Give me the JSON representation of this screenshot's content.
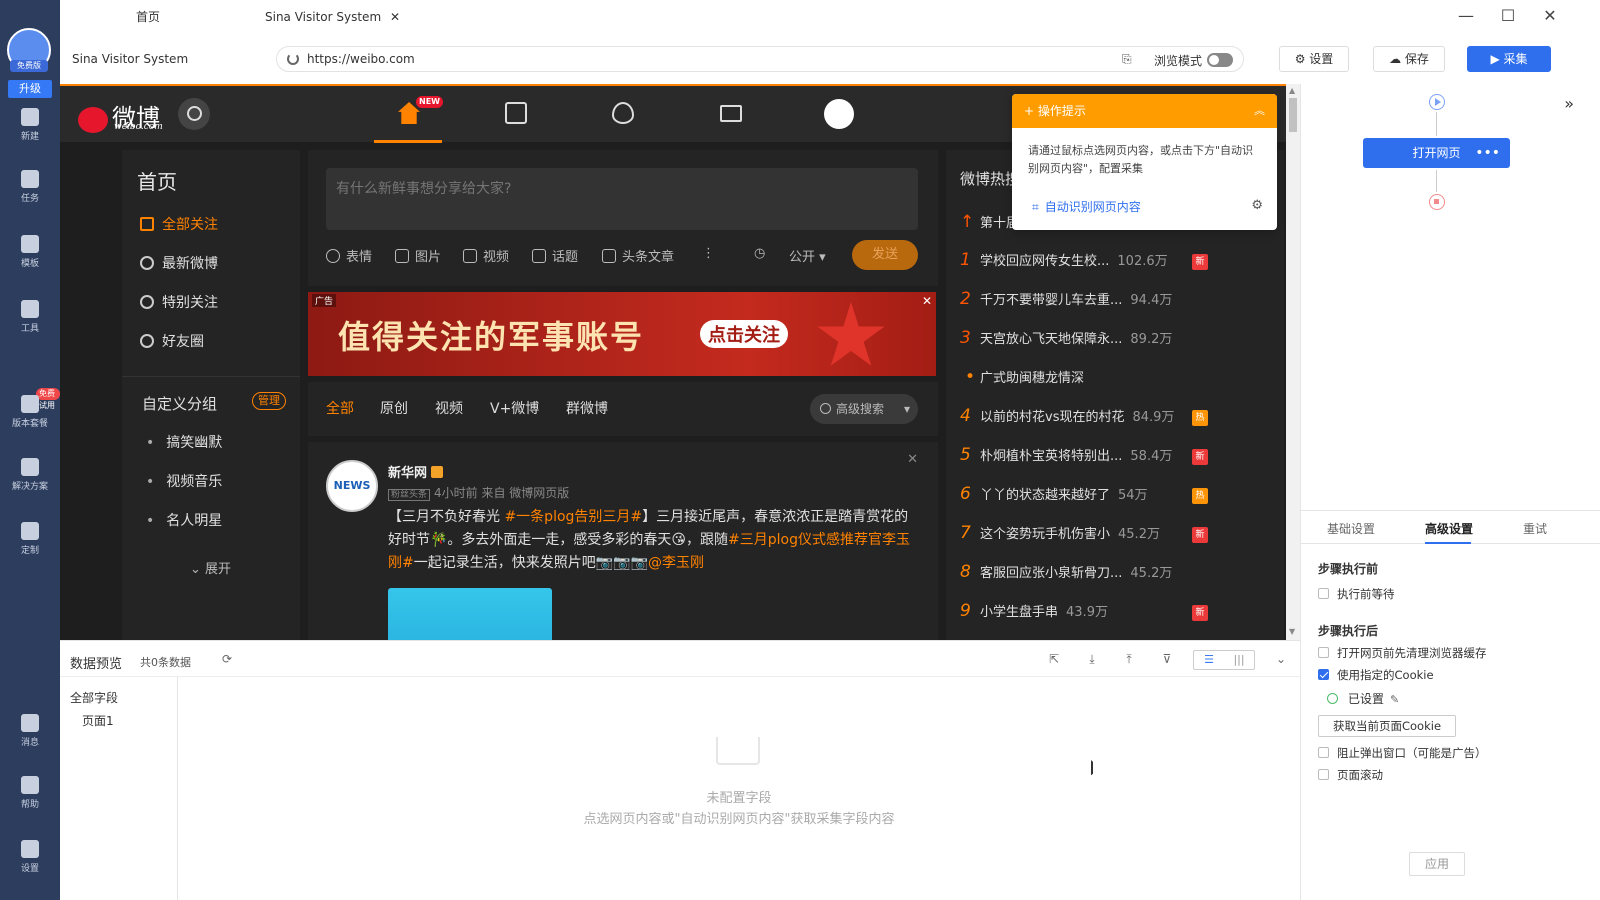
{
  "rail": {
    "avatar_tag": "免费版",
    "upgrade": "升级",
    "items": [
      {
        "label": "新建",
        "icon": "plus-icon"
      },
      {
        "label": "任务",
        "icon": "bookmark-icon"
      },
      {
        "label": "模板",
        "icon": "template-icon"
      },
      {
        "label": "工具",
        "icon": "toolbox-icon"
      },
      {
        "label": "版本套餐",
        "icon": "crown-icon"
      },
      {
        "label": "解决方案",
        "icon": "solution-icon"
      },
      {
        "label": "定制",
        "icon": "custom-icon"
      },
      {
        "label": "消息",
        "icon": "bell-icon"
      },
      {
        "label": "帮助",
        "icon": "help-icon"
      },
      {
        "label": "设置",
        "icon": "gear-icon"
      }
    ],
    "trial_badge": "免费试用"
  },
  "titlebar": {
    "tabs": [
      "首页",
      "Sina Visitor System"
    ],
    "close_tab": "✕",
    "minimize": "—",
    "maximize": "☐",
    "close": "✕"
  },
  "address": {
    "site_title": "Sina Visitor System",
    "url": "https://weibo.com",
    "browse_mode": "浏览模式",
    "settings": "设置",
    "save": "保存",
    "collect": "▶ 采集"
  },
  "weibo": {
    "logo": "微博",
    "logo_sub": "weibo.com",
    "nav_new": "NEW",
    "left": {
      "title": "首页",
      "items": [
        "全部关注",
        "最新微博",
        "特别关注",
        "好友圈"
      ],
      "group_title": "自定义分组",
      "manage": "管理",
      "subs": [
        "搞笑幽默",
        "视频音乐",
        "名人明星"
      ],
      "expand": "⌄ 展开"
    },
    "composer": {
      "placeholder": "有什么新鲜事想分享给大家?",
      "tools": [
        "表情",
        "图片",
        "视频",
        "话题",
        "头条文章"
      ],
      "more": "⋮",
      "visibility": "公开 ▾",
      "send": "发送"
    },
    "ad": {
      "label": "广告",
      "text": "值得关注的军事账号",
      "button": "点击关注",
      "close": "✕"
    },
    "filters": [
      "全部",
      "原创",
      "视频",
      "V+微博",
      "群微博"
    ],
    "advanced_search": "高级搜索",
    "post": {
      "avatar_text": "NEWS",
      "name": "新华网",
      "fan_badge": "粉丝头条",
      "meta": "4小时前 来自 微博网页版",
      "text_parts": [
        {
          "t": "【三月不负好春光 ",
          "tag": false
        },
        {
          "t": "#一条plog告别三月#",
          "tag": true
        },
        {
          "t": "】三月接近尾声，春意浓浓正是踏青赏花的好时节🎋。多去外面走一走，感受多彩的春天😘，跟随",
          "tag": false
        },
        {
          "t": "#三月plog仪式感推荐官李玉刚#",
          "tag": true
        },
        {
          "t": "一起记录生活，快来发照片吧📷📷📷",
          "tag": false
        },
        {
          "t": "@李玉刚",
          "tag": true
        }
      ],
      "close": "✕"
    },
    "hot": {
      "title": "微博热搜",
      "pinned": "第十届",
      "rows": [
        {
          "rank": "1",
          "text": "学校回应网传女生校...",
          "count": "102.6万",
          "badge": "新"
        },
        {
          "rank": "2",
          "text": "千万不要带婴儿车去重...",
          "count": "94.4万",
          "badge": ""
        },
        {
          "rank": "3",
          "text": "天宫放心飞天地保障永...",
          "count": "89.2万",
          "badge": ""
        },
        {
          "rank": "•",
          "text": "广式助闽穗龙情深",
          "count": "",
          "badge": ""
        },
        {
          "rank": "4",
          "text": "以前的村花vs现在的村花",
          "count": "84.9万",
          "badge": "热"
        },
        {
          "rank": "5",
          "text": "朴炯植朴宝英将特别出...",
          "count": "58.4万",
          "badge": "新"
        },
        {
          "rank": "6",
          "text": "丫丫的状态越来越好了",
          "count": "54万",
          "badge": "热"
        },
        {
          "rank": "7",
          "text": "这个姿势玩手机伤害小",
          "count": "45.2万",
          "badge": "新"
        },
        {
          "rank": "8",
          "text": "客服回应张小泉斩骨刀...",
          "count": "45.2万",
          "badge": ""
        },
        {
          "rank": "9",
          "text": "小学生盘手串",
          "count": "43.9万",
          "badge": "新"
        }
      ]
    }
  },
  "tip": {
    "title": "+ 操作提示",
    "collapse": "︽",
    "body": "请通过鼠标点选网页内容，或点击下方\"自动识别网页内容\"，配置采集",
    "link": "自动识别网页内容",
    "gear": "⚙"
  },
  "preview": {
    "title": "数据预览",
    "count": "共0条数据",
    "refresh": "⟳",
    "fields_all": "全部字段",
    "page1": "页面1",
    "view_list": "☰",
    "view_cols": "|||",
    "collapse": "⌄",
    "empty_title": "未配置字段",
    "empty_hint": "点选网页内容或\"自动识别网页内容\"获取采集字段内容"
  },
  "right": {
    "step": "打开网页",
    "more": "•••",
    "collapse": "»",
    "tabs": [
      "基础设置",
      "高级设置",
      "重试"
    ],
    "before_title": "步骤执行前",
    "before_items": [
      {
        "label": "执行前等待",
        "checked": false
      }
    ],
    "after_title": "步骤执行后",
    "after_items": [
      {
        "label": "打开网页前先清理浏览器缓存",
        "checked": false
      },
      {
        "label": "使用指定的Cookie",
        "checked": true
      }
    ],
    "cookie_set": "已设置",
    "cookie_edit": "✎",
    "get_cookie": "获取当前页面Cookie",
    "more_items": [
      {
        "label": "阻止弹出窗口（可能是广告）",
        "checked": false
      },
      {
        "label": "页面滚动",
        "checked": false
      }
    ],
    "apply": "应用"
  }
}
